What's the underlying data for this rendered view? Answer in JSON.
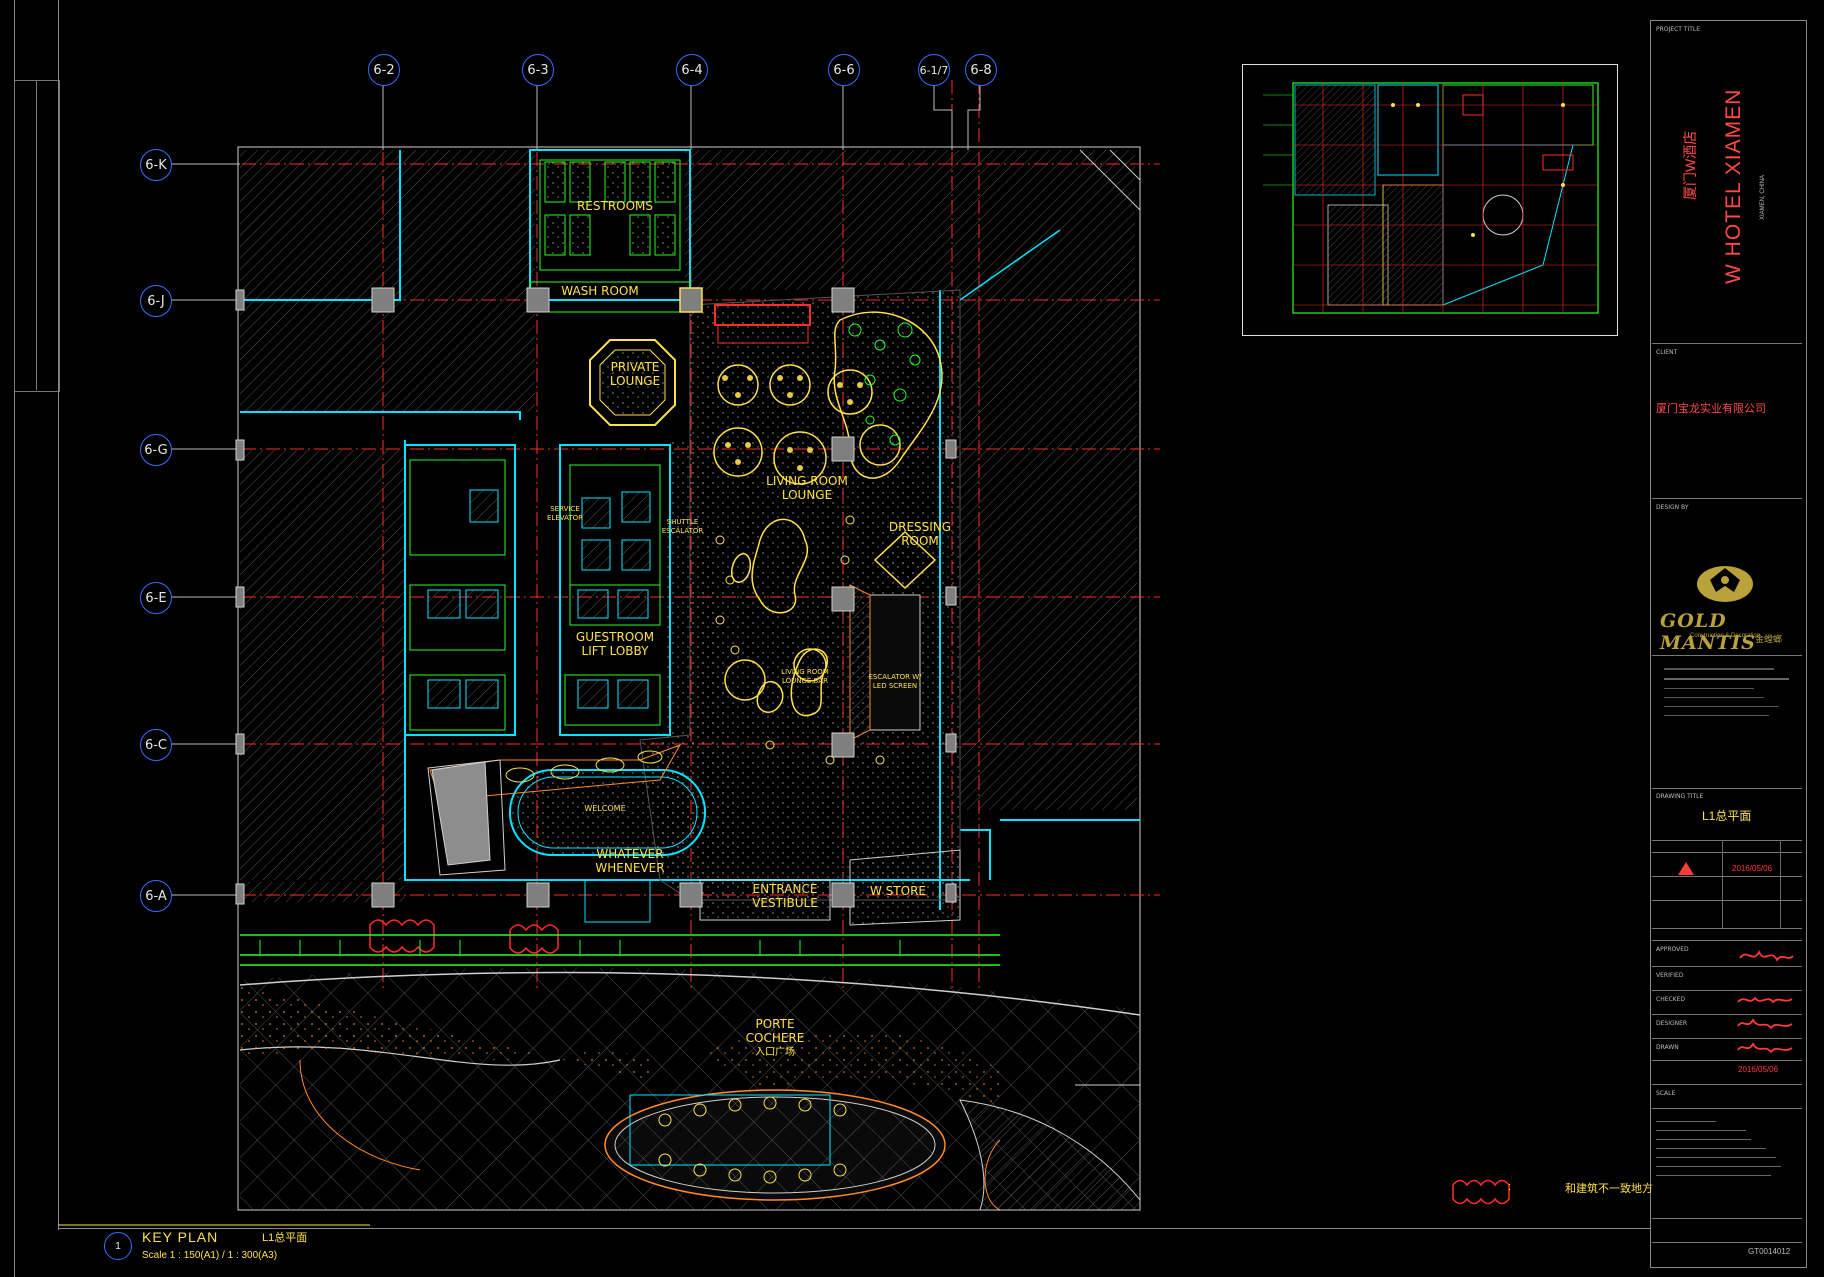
{
  "grid_axes": {
    "columns": [
      "6-2",
      "6-3",
      "6-4",
      "6-6",
      "6-1/7",
      "6-8"
    ],
    "rows": [
      "6-K",
      "6-J",
      "6-G",
      "6-E",
      "6-C",
      "6-A"
    ]
  },
  "rooms": {
    "restrooms": "RESTROOMS",
    "wash_room": "WASH ROOM",
    "private_lounge_en": "PRIVATE\nLOUNGE",
    "living_room_lounge": "LIVING ROOM\nLOUNGE",
    "dressing_room": "DRESSING\nROOM",
    "service_elevator": "SERVICE\nELEVATOR",
    "shuttle_escalator": "SHUTTLE\nESCALATOR",
    "guestroom_lift_lobby": "GUESTROOM\nLIFT LOBBY",
    "living_room_lounge_bar": "LIVING ROOM\nLOUNGE BAR",
    "escalator_led": "ESCALATOR W/\nLED SCREEN",
    "whatever_whenever": "WHATEVER WHENEVER",
    "welcome": "WELCOME",
    "entrance_vestibule": "ENTRANCE\nVESTIBULE",
    "w_store": "W STORE",
    "porte_cochere": "PORTE\nCOCHERE",
    "porte_cochere_cn": "入口广场"
  },
  "legend": {
    "note_cn": "和建筑不一致地方"
  },
  "key_plan": {
    "number": "1",
    "title": "KEY PLAN",
    "title_cn": "L1总平面",
    "scale": "Scale 1 : 150(A1) / 1 : 300(A3)"
  },
  "title_block": {
    "project_title_label": "PROJECT TITLE",
    "project_name_en": "W HOTEL XIAMEN",
    "project_name_cn": "厦门W酒店",
    "project_location": "XIAMEN, CHINA",
    "client_label": "CLIENT",
    "client_name": "厦门宝龙实业有限公司",
    "design_by_label": "DESIGN BY",
    "company_name": "GOLD MANTIS",
    "company_sub": "Construction & Decoration",
    "company_cn": "金螳螂",
    "drawing_title_label": "DRAWING TITLE",
    "drawing_title": "L1总平面",
    "revision_date": "2016/05/06",
    "approved_label": "APPROVED",
    "verified_label": "VERIFIED",
    "checked_label": "CHECKED",
    "designer_label": "DESIGNER",
    "drawn_label": "DRAWN",
    "drawn_date": "2016/05/06",
    "scale_label": "SCALE",
    "drawing_no": "GT0014012"
  },
  "colors": {
    "grid_bubble": "#3b6cff",
    "gridline_red": "#ff2a2a",
    "label_yellow": "#ffe14a",
    "plan_cyan": "#00e5ff",
    "plan_green": "#22ff22",
    "title_red": "#ff3a3a"
  }
}
